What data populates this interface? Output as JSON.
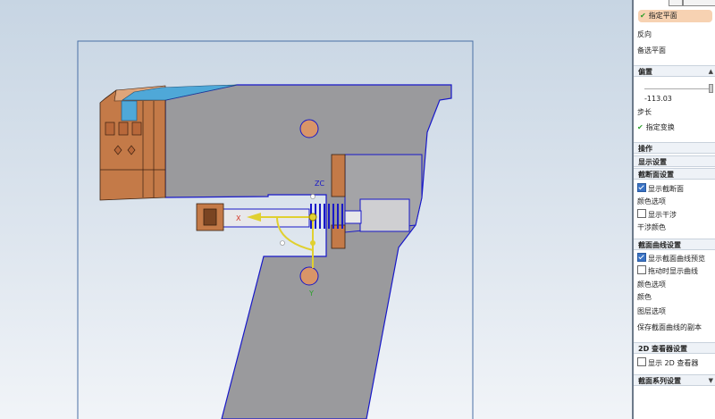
{
  "viewport": {
    "axis_labels": {
      "x": "X",
      "y": "Y",
      "zc": "ZC"
    },
    "colors": {
      "part_gray": "#9a9a9d",
      "copper": "#c47a48",
      "cyan": "#4fa8d8",
      "outline": "#1818c8",
      "bg_top": "#c7d5e3",
      "bg_bottom": "#f1f4f8"
    }
  },
  "panel": {
    "plane": {
      "specify_plane": "指定平面",
      "reverse": "反向",
      "alternate_plane": "备选平面"
    },
    "offset": {
      "header": "偏置",
      "value": "-113.03",
      "step": "步长",
      "specify_transform": "指定变换"
    },
    "operation": "操作",
    "display_settings": "显示设置",
    "section_settings": {
      "header": "截断面设置",
      "show_section": "显示截断面",
      "color_options": "颜色选项",
      "show_interference": "显示干涉",
      "interference_color": "干涉颜色"
    },
    "section_curve_settings": {
      "header": "截面曲线设置",
      "show_preview": "显示截面曲线预览",
      "show_when_drag": "拖动时显示曲线",
      "color_options": "颜色选项",
      "color": "颜色",
      "layer_options": "图层选项",
      "save_copy": "保存截面曲线的副本"
    },
    "viewer_2d": {
      "header": "2D 查看器设置",
      "show_viewer": "显示 2D 查看器"
    },
    "section_series": "截面系列设置"
  }
}
